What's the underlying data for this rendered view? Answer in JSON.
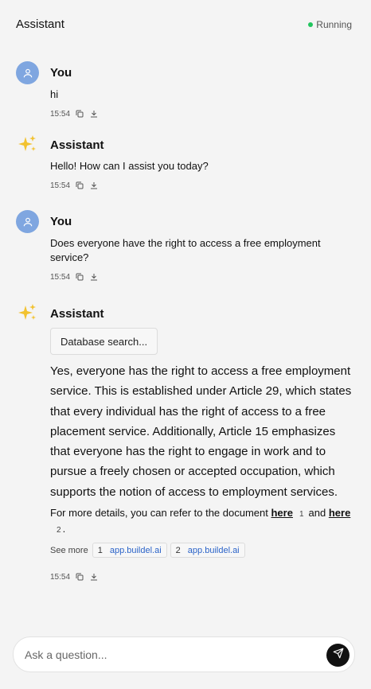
{
  "header": {
    "title": "Assistant",
    "status": "Running",
    "status_color": "#22c55e"
  },
  "messages": [
    {
      "author": "You",
      "role": "user",
      "avatar_icon": "user-icon",
      "text": "hi",
      "time": "15:54"
    },
    {
      "author": "Assistant",
      "role": "assistant",
      "avatar_icon": "sparkles-icon",
      "text": "Hello! How can I assist you today?",
      "time": "15:54"
    },
    {
      "author": "You",
      "role": "user",
      "avatar_icon": "user-icon",
      "text": "Does everyone have the right to access a free employment service?",
      "time": "15:54"
    },
    {
      "author": "Assistant",
      "role": "assistant",
      "avatar_icon": "sparkles-icon",
      "tool_label": "Database search...",
      "answer": "Yes, everyone has the right to access a free employment service. This is established under Article 29, which states that every individual has the right of access to a free placement service. Additionally, Article 15 emphasizes that everyone has the right to engage in work and to pursue a freely chosen or accepted occupation, which supports the notion of access to employment services.",
      "details_prefix": "For more details, you can refer to the document",
      "link1": "here",
      "ref1": "1",
      "details_and": "and",
      "link2": "here",
      "ref2": "2",
      "details_suffix": ".",
      "see_more_label": "See more",
      "sources": [
        {
          "num": "1",
          "label": "app.buildel.ai"
        },
        {
          "num": "2",
          "label": "app.buildel.ai"
        }
      ],
      "time": "15:54"
    }
  ],
  "composer": {
    "placeholder": "Ask a question...",
    "send_icon": "send-icon"
  }
}
